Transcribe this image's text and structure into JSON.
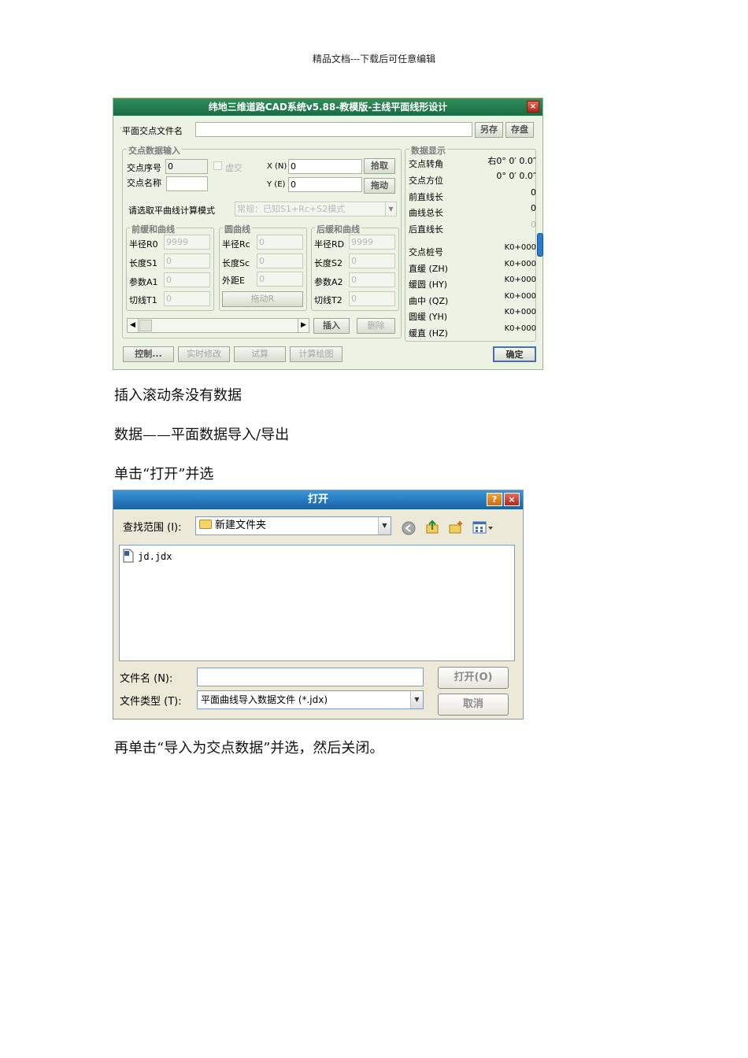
{
  "page": {
    "header_note": "精品文档---下载后可任意编辑",
    "para1": "插入滚动条没有数据",
    "para2": "数据——平面数据导入/导出",
    "para3": "单击“打开”并选",
    "para4": "再单击“导入为交点数据”并选，然后关闭。"
  },
  "cad_dialog": {
    "title": "纬地三维道路CAD系统v5.88-教模版-主线平面线形设计",
    "close": "×",
    "file_label": "平面交点文件名",
    "save_as": "另存",
    "save": "存盘",
    "input_group": "交点数据输入",
    "seq_label": "交点序号",
    "seq_value": "0",
    "virtual_label": "虚交",
    "x_label": "X (N)",
    "x_value": "0",
    "y_label": "Y (E)",
    "y_value": "0",
    "pick_btn": "拾取",
    "drag_btn": "拖动",
    "name_label": "交点名称",
    "mode_label": "请选取平曲线计算模式",
    "mode_value": "常规：已知S1+Rc+S2模式",
    "front_group": "前缓和曲线",
    "circle_group": "圆曲线",
    "back_group": "后缓和曲线",
    "r0_label": "半径R0",
    "r0_value": "9999",
    "s1_label": "长度S1",
    "s1_value": "0",
    "a1_label": "参数A1",
    "a1_value": "0",
    "t1_label": "切线T1",
    "t1_value": "0",
    "rc_label": "半径Rc",
    "rc_value": "0",
    "sc_label": "长度Sc",
    "sc_value": "0",
    "e_label": "外距E",
    "e_value": "0",
    "drag_r": "拖动R",
    "rd_label": "半径RD",
    "rd_value": "9999",
    "s2_label": "长度S2",
    "s2_value": "0",
    "a2_label": "参数A2",
    "a2_value": "0",
    "t2_label": "切线T2",
    "t2_value": "0",
    "insert_btn": "插入",
    "delete_btn": "删除",
    "control_btn": "控制...",
    "realtime_btn": "实时修改",
    "trial_btn": "试算",
    "calc_btn": "计算绘图",
    "ok_btn": "确定",
    "display_group": "数据显示",
    "display_rows": [
      {
        "k": "交点转角",
        "v": "右0° 0′ 0.0″"
      },
      {
        "k": "交点方位",
        "v": "0° 0′ 0.0″"
      },
      {
        "k": "前直线长",
        "v": "0"
      },
      {
        "k": "曲线总长",
        "v": "0"
      },
      {
        "k": "后直线长",
        "v": "0"
      },
      {
        "k": "交点桩号",
        "v": "K0+000"
      },
      {
        "k": "直缓 (ZH)",
        "v": "K0+000"
      },
      {
        "k": "缓圆 (HY)",
        "v": "K0+000"
      },
      {
        "k": "曲中 (QZ)",
        "v": "K0+000"
      },
      {
        "k": "圆缓 (YH)",
        "v": "K0+000"
      },
      {
        "k": "缓直 (HZ)",
        "v": "K0+000"
      }
    ]
  },
  "open_dialog": {
    "title": "打开",
    "help": "?",
    "close": "×",
    "lookin_label": "查找范围 (I):",
    "lookin_value": "新建文件夹",
    "file_item": "jd.jdx",
    "filename_label": "文件名 (N):",
    "filename_value": "",
    "filetype_label": "文件类型 (T):",
    "filetype_value": "平面曲线导入数据文件 (*.jdx)",
    "open_btn": "打开(O)",
    "cancel_btn": "取消"
  }
}
